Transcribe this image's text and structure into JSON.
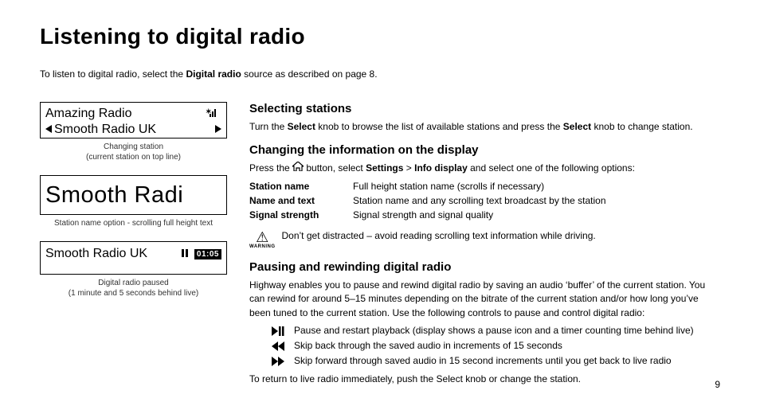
{
  "title": "Listening to digital radio",
  "intro_pre": "To listen to digital radio, select the ",
  "intro_bold": "Digital radio",
  "intro_post": " source as described on page 8.",
  "panel1": {
    "line1": "Amazing Radio",
    "line2": "Smooth Radio UK",
    "caption": "Changing station\n(current station on top line)"
  },
  "panel2": {
    "text": "Smooth Radi",
    "caption": "Station name option - scrolling full height text"
  },
  "panel3": {
    "label": "Smooth Radio UK",
    "timer": "01:05",
    "caption": "Digital radio paused\n(1 minute and 5 seconds behind live)"
  },
  "section1": {
    "heading": "Selecting stations",
    "text_pre": "Turn the ",
    "kw1": "Select",
    "text_mid": " knob to browse the list of available stations and press the ",
    "kw2": "Select",
    "text_post": " knob to change station."
  },
  "section2": {
    "heading": "Changing the information on the display",
    "lead_pre": "Press the ",
    "lead_mid": " button, select ",
    "kw_settings": "Settings",
    "gt": " > ",
    "kw_info": "Info display",
    "lead_post": " and select one of the following options:",
    "defs": [
      {
        "k": "Station name",
        "v": "Full height station name (scrolls if necessary)"
      },
      {
        "k": "Name and text",
        "v": "Station name and any scrolling text broadcast by the station"
      },
      {
        "k": "Signal strength",
        "v": "Signal strength and signal quality"
      }
    ],
    "warning_label": "WARNING",
    "warning_text": "Don’t get distracted – avoid reading scrolling text information while driving."
  },
  "section3": {
    "heading": "Pausing and rewinding digital radio",
    "para": "Highway enables you to pause and rewind digital radio by saving an audio ‘buffer’ of the current station. You can rewind for around 5–15 minutes depending on the bitrate of the current station and/or how long you’ve been tuned to the current station. Use the following controls to pause and control digital radio:",
    "controls": [
      "Pause and restart playback (display shows a pause icon and a timer counting time behind live)",
      "Skip back through the saved audio in increments of 15 seconds",
      "Skip forward through saved audio in 15 second increments until you get back to live radio"
    ],
    "return": "To return to live radio immediately, push the Select knob or change the station."
  },
  "page_number": "9"
}
